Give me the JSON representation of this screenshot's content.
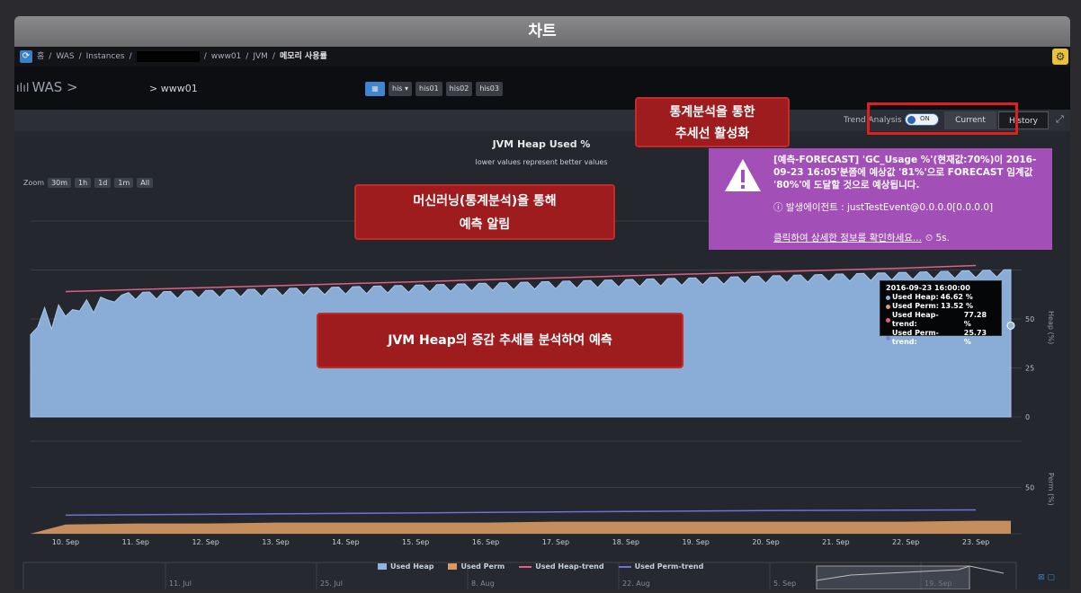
{
  "window": {
    "title": "차트"
  },
  "breadcrumb": {
    "home": "홈",
    "items": [
      "WAS",
      "Instances",
      "www01",
      "JVM"
    ],
    "current": "메모리 사용률"
  },
  "header": {
    "title": "WAS >",
    "server": "> www01",
    "buttons": [
      "his ▾",
      "his01",
      "his02",
      "his03"
    ]
  },
  "toolbar": {
    "trend_label": "Trend Analysis",
    "toggle_text": "ON",
    "tab_current": "Current",
    "tab_history": "History"
  },
  "chart": {
    "title": "JVM Heap Used %",
    "subtitle": "lower values represent better values",
    "zoom_label": "Zoom",
    "zoom_buttons": [
      "30m",
      "1h",
      "1d",
      "1m",
      "All"
    ]
  },
  "callouts": {
    "trend": {
      "line1": "통계분석을 통한",
      "line2": "추세선 활성화"
    },
    "ml": {
      "line1": "머신러닝(통계분석)을 통해",
      "line2": "예측 알림"
    },
    "heap": {
      "line1": "JVM Heap의 증감 추세를 분석하여 예측"
    }
  },
  "alert": {
    "message": "[예측-FORECAST] 'GC_Usage %'(현재값:70%)이 2016-09-23 16:05'분쯤에 예상값 '81%'으로 FORECAST 임계값 '80%'에 도달할 것으로 예상됩니다.",
    "agent": "발생에이전트 : justTestEvent@0.0.0.0[0.0.0.0]",
    "link": "클릭하여 상세한 정보를 확인하세요...",
    "time": "5s."
  },
  "tooltip": {
    "time": "2016-09-23 16:00:00",
    "rows": [
      {
        "label": "Used Heap:",
        "value": "46.62 %",
        "color": "#8fb4e0"
      },
      {
        "label": "Used Perm:",
        "value": "13.52 %",
        "color": "#e0a06a"
      },
      {
        "label": "Used Heap-trend:",
        "value": "77.28 %",
        "color": "#e06080"
      },
      {
        "label": "Used Perm-trend:",
        "value": "25.73 %",
        "color": "#8080e0"
      }
    ]
  },
  "chart_data": {
    "type": "area",
    "title": "JVM Heap Used %",
    "subtitle": "lower values represent better values",
    "categories": [
      "10. Sep",
      "11. Sep",
      "12. Sep",
      "13. Sep",
      "14. Sep",
      "15. Sep",
      "16. Sep",
      "17. Sep",
      "18. Sep",
      "19. Sep",
      "20. Sep",
      "21. Sep",
      "22. Sep",
      "23. Sep"
    ],
    "heap_axis": {
      "label": "Heap (%)",
      "ticks": [
        "0",
        "25",
        "50"
      ]
    },
    "perm_axis": {
      "label": "Perm (%)",
      "ticks": [
        "50"
      ]
    },
    "series": [
      {
        "name": "Used Heap",
        "values": [
          60,
          62,
          63,
          64,
          65,
          66,
          67,
          68,
          69,
          70,
          71,
          72,
          73,
          74
        ],
        "color": "#8fb4e0"
      },
      {
        "name": "Used Perm",
        "values": [
          10,
          11,
          11,
          12,
          12,
          12,
          12,
          13,
          13,
          13,
          13,
          13,
          13,
          14
        ],
        "color": "#d89a62"
      },
      {
        "name": "Used Heap-trend",
        "values": [
          64,
          65,
          66,
          67,
          68,
          69,
          70,
          71,
          72,
          73,
          74,
          75,
          76,
          77.28
        ],
        "color": "#e06080"
      },
      {
        "name": "Used Perm-trend",
        "values": [
          20,
          20.5,
          21,
          21.5,
          22,
          22.5,
          23,
          23.5,
          24,
          24.5,
          25,
          25.2,
          25.5,
          25.73
        ],
        "color": "#7070d8"
      }
    ],
    "navigator_labels": [
      "11. Jul",
      "25. Jul",
      "8. Aug",
      "22. Aug",
      "5. Sep",
      "19. Sep"
    ],
    "legend": [
      "Used Heap",
      "Used Perm",
      "Used Heap-trend",
      "Used Perm-trend"
    ]
  }
}
